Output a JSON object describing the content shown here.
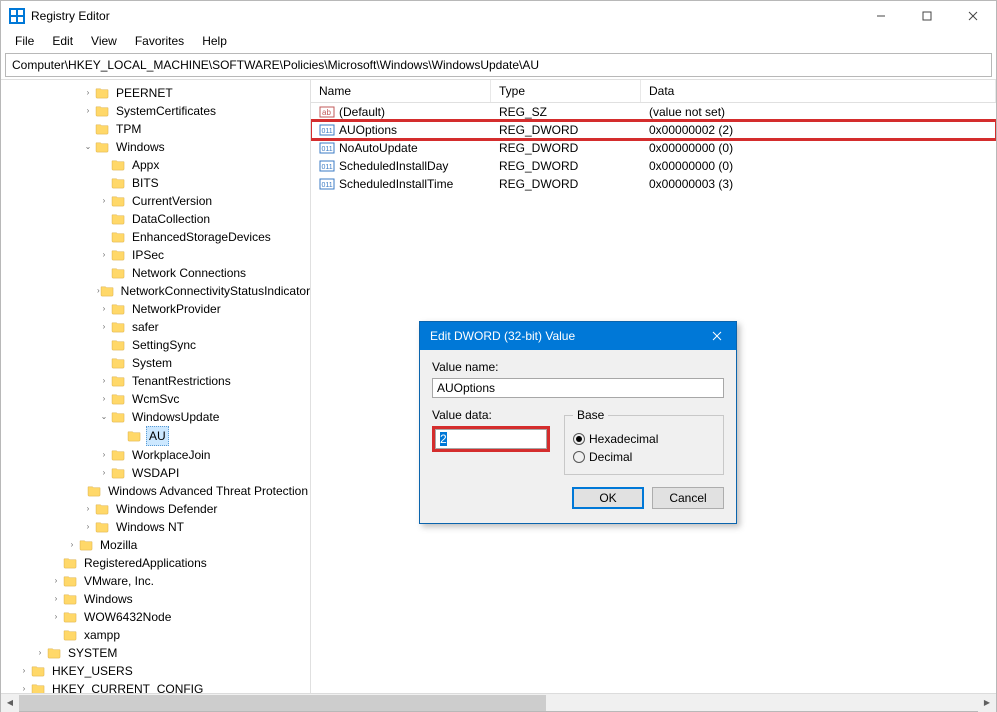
{
  "window": {
    "title": "Registry Editor"
  },
  "menu": {
    "file": "File",
    "edit": "Edit",
    "view": "View",
    "favorites": "Favorites",
    "help": "Help"
  },
  "address": "Computer\\HKEY_LOCAL_MACHINE\\SOFTWARE\\Policies\\Microsoft\\Windows\\WindowsUpdate\\AU",
  "tree": [
    {
      "depth": 5,
      "label": "PEERNET",
      "exp": ">"
    },
    {
      "depth": 5,
      "label": "SystemCertificates",
      "exp": ">"
    },
    {
      "depth": 5,
      "label": "TPM",
      "exp": ""
    },
    {
      "depth": 5,
      "label": "Windows",
      "exp": "v"
    },
    {
      "depth": 6,
      "label": "Appx",
      "exp": ""
    },
    {
      "depth": 6,
      "label": "BITS",
      "exp": ""
    },
    {
      "depth": 6,
      "label": "CurrentVersion",
      "exp": ">"
    },
    {
      "depth": 6,
      "label": "DataCollection",
      "exp": ""
    },
    {
      "depth": 6,
      "label": "EnhancedStorageDevices",
      "exp": ""
    },
    {
      "depth": 6,
      "label": "IPSec",
      "exp": ">"
    },
    {
      "depth": 6,
      "label": "Network Connections",
      "exp": ""
    },
    {
      "depth": 6,
      "label": "NetworkConnectivityStatusIndicator",
      "exp": ">"
    },
    {
      "depth": 6,
      "label": "NetworkProvider",
      "exp": ">"
    },
    {
      "depth": 6,
      "label": "safer",
      "exp": ">"
    },
    {
      "depth": 6,
      "label": "SettingSync",
      "exp": ""
    },
    {
      "depth": 6,
      "label": "System",
      "exp": ""
    },
    {
      "depth": 6,
      "label": "TenantRestrictions",
      "exp": ">"
    },
    {
      "depth": 6,
      "label": "WcmSvc",
      "exp": ">"
    },
    {
      "depth": 6,
      "label": "WindowsUpdate",
      "exp": "v"
    },
    {
      "depth": 7,
      "label": "AU",
      "exp": "",
      "selected": true
    },
    {
      "depth": 6,
      "label": "WorkplaceJoin",
      "exp": ">"
    },
    {
      "depth": 6,
      "label": "WSDAPI",
      "exp": ">"
    },
    {
      "depth": 5,
      "label": "Windows Advanced Threat Protection",
      "exp": ""
    },
    {
      "depth": 5,
      "label": "Windows Defender",
      "exp": ">"
    },
    {
      "depth": 5,
      "label": "Windows NT",
      "exp": ">"
    },
    {
      "depth": 4,
      "label": "Mozilla",
      "exp": ">"
    },
    {
      "depth": 3,
      "label": "RegisteredApplications",
      "exp": ""
    },
    {
      "depth": 3,
      "label": "VMware, Inc.",
      "exp": ">"
    },
    {
      "depth": 3,
      "label": "Windows",
      "exp": ">"
    },
    {
      "depth": 3,
      "label": "WOW6432Node",
      "exp": ">"
    },
    {
      "depth": 3,
      "label": "xampp",
      "exp": ""
    },
    {
      "depth": 2,
      "label": "SYSTEM",
      "exp": ">"
    },
    {
      "depth": 1,
      "label": "HKEY_USERS",
      "exp": ">"
    },
    {
      "depth": 1,
      "label": "HKEY_CURRENT_CONFIG",
      "exp": ">"
    }
  ],
  "columns": {
    "name": "Name",
    "type": "Type",
    "data": "Data"
  },
  "rows": [
    {
      "icon": "sz",
      "name": "(Default)",
      "type": "REG_SZ",
      "data": "(value not set)"
    },
    {
      "icon": "dw",
      "name": "AUOptions",
      "type": "REG_DWORD",
      "data": "0x00000002 (2)",
      "highlight": true
    },
    {
      "icon": "dw",
      "name": "NoAutoUpdate",
      "type": "REG_DWORD",
      "data": "0x00000000 (0)"
    },
    {
      "icon": "dw",
      "name": "ScheduledInstallDay",
      "type": "REG_DWORD",
      "data": "0x00000000 (0)"
    },
    {
      "icon": "dw",
      "name": "ScheduledInstallTime",
      "type": "REG_DWORD",
      "data": "0x00000003 (3)"
    }
  ],
  "dialog": {
    "title": "Edit DWORD (32-bit) Value",
    "value_name_label": "Value name:",
    "value_name": "AUOptions",
    "value_data_label": "Value data:",
    "value_data": "2",
    "base_label": "Base",
    "hex_label": "Hexadecimal",
    "dec_label": "Decimal",
    "ok": "OK",
    "cancel": "Cancel"
  }
}
